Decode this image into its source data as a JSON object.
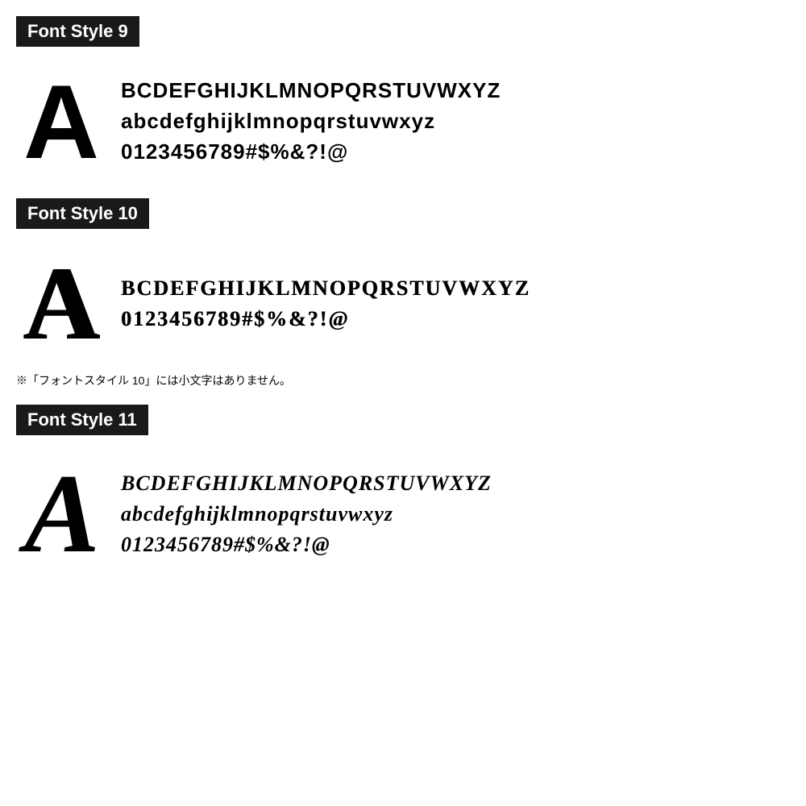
{
  "sections": [
    {
      "id": "font-style-9",
      "title": "Font Style 9",
      "big_letter": "A",
      "lines": [
        "BCDEFGHIJKLMNOPQRSTUVWXYZ",
        "abcdefghijklmnopqrstuvwxyz",
        "0123456789#$%&?!@"
      ],
      "note": null
    },
    {
      "id": "font-style-10",
      "title": "Font Style 10",
      "big_letter": "A",
      "lines": [
        "BCDEFGHIJKLMNOPQRSTUVWXYZ",
        "0123456789#$%&?!@"
      ],
      "note": "※「フォントスタイル 10」には小文字はありません。"
    },
    {
      "id": "font-style-11",
      "title": "Font Style 11",
      "big_letter": "A",
      "lines": [
        "BCDEFGHIJKLMNOPQRSTUVWXYZ",
        "abcdefghijklmnopqrstuvwxyz",
        "0123456789#$%&?!@"
      ],
      "note": null
    }
  ]
}
